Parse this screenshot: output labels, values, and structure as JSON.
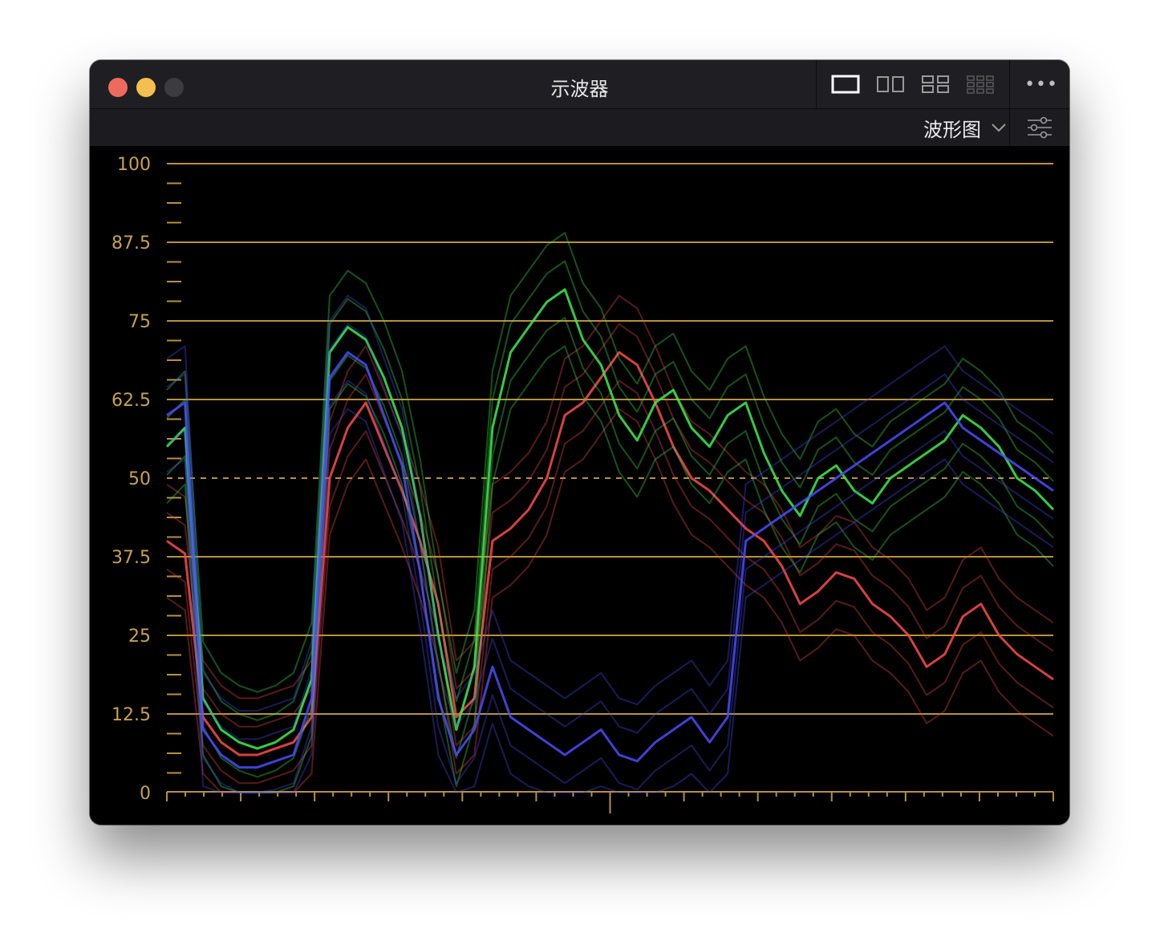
{
  "window": {
    "title": "示波器",
    "layout_options": [
      "single-view-icon",
      "dual-view-icon",
      "quad-view-icon",
      "multi-view-icon"
    ],
    "selected_layout": "single-view-icon",
    "more_label": "•••"
  },
  "toolbar": {
    "mode_label": "波形图",
    "mode_icon": "chevron-down-icon",
    "settings_icon": "sliders-icon"
  },
  "colors": {
    "graticule": "#b8923a",
    "label": "#c9a24a",
    "trace_red": "#ff4b4b",
    "trace_green": "#3cf04c",
    "trace_blue": "#4a4cff"
  },
  "chart_data": {
    "type": "waveform",
    "ylim": [
      0,
      100
    ],
    "y_ticks": [
      "100",
      "87.5",
      "75",
      "62.5",
      "50",
      "37.5",
      "25",
      "12.5",
      "0"
    ],
    "grid": true,
    "dashed_line_at": 50,
    "series": [
      {
        "name": "",
        "color": "red",
        "values": [
          40,
          38,
          12,
          8,
          6,
          6,
          7,
          8,
          12,
          50,
          58,
          62,
          55,
          48,
          40,
          30,
          12,
          15,
          40,
          42,
          45,
          50,
          60,
          62,
          66,
          70,
          68,
          62,
          55,
          50,
          48,
          45,
          42,
          40,
          36,
          30,
          32,
          35,
          34,
          30,
          28,
          25,
          20,
          22,
          28,
          30,
          25,
          22,
          20,
          18
        ]
      },
      {
        "name": "",
        "color": "green",
        "values": [
          55,
          58,
          15,
          10,
          8,
          7,
          8,
          10,
          18,
          70,
          74,
          72,
          66,
          58,
          44,
          25,
          10,
          20,
          58,
          70,
          74,
          78,
          80,
          72,
          68,
          60,
          56,
          62,
          64,
          58,
          55,
          60,
          62,
          54,
          48,
          44,
          50,
          52,
          48,
          46,
          50,
          52,
          54,
          56,
          60,
          58,
          55,
          50,
          48,
          45
        ]
      },
      {
        "name": "",
        "color": "blue",
        "values": [
          60,
          62,
          10,
          6,
          4,
          4,
          5,
          6,
          15,
          66,
          70,
          68,
          60,
          52,
          35,
          15,
          6,
          10,
          20,
          12,
          10,
          8,
          6,
          8,
          10,
          6,
          5,
          8,
          10,
          12,
          8,
          12,
          40,
          42,
          44,
          46,
          48,
          50,
          52,
          54,
          56,
          58,
          60,
          62,
          58,
          56,
          54,
          52,
          50,
          48
        ]
      }
    ]
  }
}
